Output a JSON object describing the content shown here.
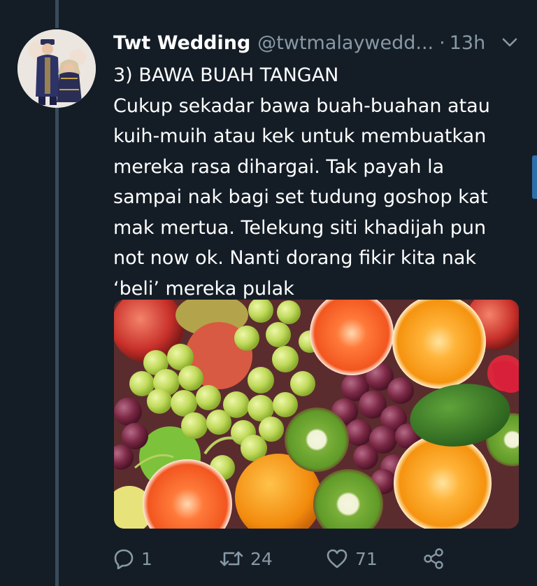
{
  "tweet": {
    "display_name": "Twt Wedding",
    "handle": "@twtmalaywedd...",
    "separator": "·",
    "time": "13h",
    "lines": [
      "3) BAWA BUAH TANGAN",
      "Cukup sekadar bawa buah-buahan atau",
      "kuih-muih atau kek untuk membuatkan",
      "mereka rasa dihargai. Tak payah la",
      "sampai nak bagi set tudung goshop kat",
      "mak mertua. Telekung siti khadijah pun",
      "not now ok. Nanti dorang fikir kita nak",
      "‘beli’ mereka pulak"
    ]
  },
  "actions": {
    "replies": "1",
    "retweets": "24",
    "likes": "71"
  },
  "icons": {
    "reply": "reply-icon",
    "retweet": "retweet-icon",
    "like": "heart-icon",
    "share": "share-icon",
    "menu": "chevron-down-icon"
  },
  "colors": {
    "background": "#141d26",
    "secondary_text": "#8899a6",
    "thread_line": "#394b5c"
  }
}
